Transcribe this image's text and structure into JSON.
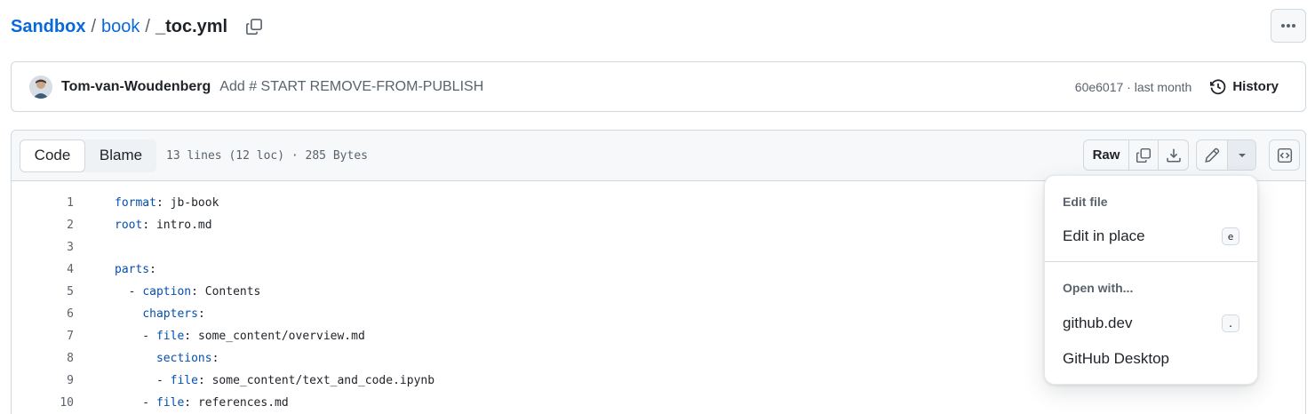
{
  "breadcrumb": {
    "repo": "Sandbox",
    "folder": "book",
    "file": "_toc.yml",
    "separator": "/"
  },
  "commit": {
    "author": "Tom-van-Woudenberg",
    "message": "Add # START REMOVE-FROM-PUBLISH",
    "sha_time": "60e6017 · last month",
    "history_label": "History"
  },
  "file_header": {
    "code_tab": "Code",
    "blame_tab": "Blame",
    "meta": "13 lines (12 loc) · 285 Bytes",
    "raw_label": "Raw"
  },
  "code": {
    "lines": [
      {
        "n": "1",
        "key": "format",
        "sep": ": ",
        "val": "jb-book",
        "indent": ""
      },
      {
        "n": "2",
        "key": "root",
        "sep": ": ",
        "val": "intro.md",
        "indent": ""
      },
      {
        "n": "3",
        "key": "",
        "sep": "",
        "val": "",
        "indent": ""
      },
      {
        "n": "4",
        "key": "parts",
        "sep": ":",
        "val": "",
        "indent": ""
      },
      {
        "n": "5",
        "key": "caption",
        "sep": ": ",
        "val": "Contents",
        "indent": "  - "
      },
      {
        "n": "6",
        "key": "chapters",
        "sep": ":",
        "val": "",
        "indent": "    "
      },
      {
        "n": "7",
        "key": "file",
        "sep": ": ",
        "val": "some_content/overview.md",
        "indent": "    - "
      },
      {
        "n": "8",
        "key": "sections",
        "sep": ":",
        "val": "",
        "indent": "      "
      },
      {
        "n": "9",
        "key": "file",
        "sep": ": ",
        "val": "some_content/text_and_code.ipynb",
        "indent": "      - "
      },
      {
        "n": "10",
        "key": "file",
        "sep": ": ",
        "val": "references.md",
        "indent": "    - "
      }
    ]
  },
  "edit_menu": {
    "section1_heading": "Edit file",
    "edit_in_place": "Edit in place",
    "edit_in_place_key": "e",
    "section2_heading": "Open with...",
    "github_dev": "github.dev",
    "github_dev_key": ".",
    "github_desktop": "GitHub Desktop"
  }
}
